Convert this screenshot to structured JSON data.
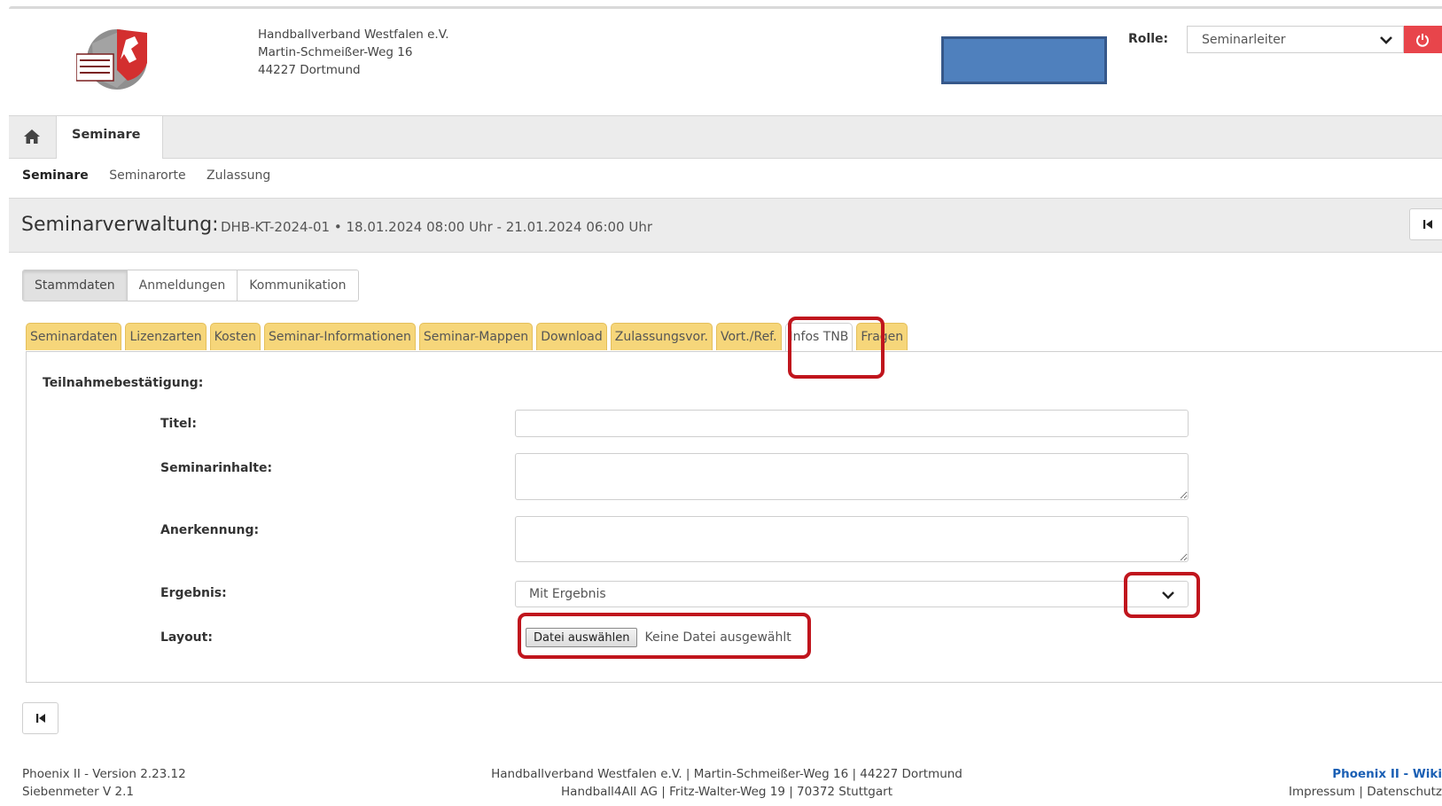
{
  "header": {
    "logo_alt": "Handballverband Westfalen Logo",
    "org_lines": [
      "Handballverband Westfalen e.V.",
      "Martin-Schmeißer-Weg 16",
      "44227 Dortmund"
    ],
    "role_label": "Rolle:",
    "role_value": "Seminarleiter",
    "accent_color": "#e8454b"
  },
  "mainnav": {
    "active_tab": "Seminare"
  },
  "subnav": [
    "Seminare",
    "Seminarorte",
    "Zulassung"
  ],
  "titlebar": {
    "title": "Seminarverwaltung:",
    "subtitle": "DHB-KT-2024-01 • 18.01.2024 08:00 Uhr - 21.01.2024 06:00 Uhr"
  },
  "view_buttons": [
    "Stammdaten",
    "Anmeldungen",
    "Kommunikation"
  ],
  "tabs": [
    "Seminardaten",
    "Lizenzarten",
    "Kosten",
    "Seminar-Informationen",
    "Seminar-Mappen",
    "Download",
    "Zulassungsvor.",
    "Vort./Ref.",
    "Infos TNB",
    "Fragen"
  ],
  "active_tab": "Infos TNB",
  "form": {
    "section_title": "Teilnahmebestätigung:",
    "titel_label": "Titel:",
    "titel_value": "",
    "seminarinhalte_label": "Seminarinhalte:",
    "seminarinhalte_value": "",
    "anerkennung_label": "Anerkennung:",
    "anerkennung_value": "",
    "ergebnis_label": "Ergebnis:",
    "ergebnis_value": "Mit Ergebnis",
    "layout_label": "Layout:",
    "file_button": "Datei auswählen",
    "file_status": "Keine Datei ausgewählt"
  },
  "footer": {
    "left_lines": [
      "Phoenix II - Version 2.23.12",
      "Siebenmeter V 2.1"
    ],
    "center_lines": [
      "Handballverband Westfalen e.V. | Martin-Schmeißer-Weg 16 | 44227 Dortmund",
      "Handball4All AG | Fritz-Walter-Weg 19 | 70372 Stuttgart"
    ],
    "wiki_link": "Phoenix II - Wiki",
    "impressum": "Impressum",
    "separator": "|",
    "datenschutz": "Datenschutz"
  },
  "highlight_color": "#c0151d"
}
